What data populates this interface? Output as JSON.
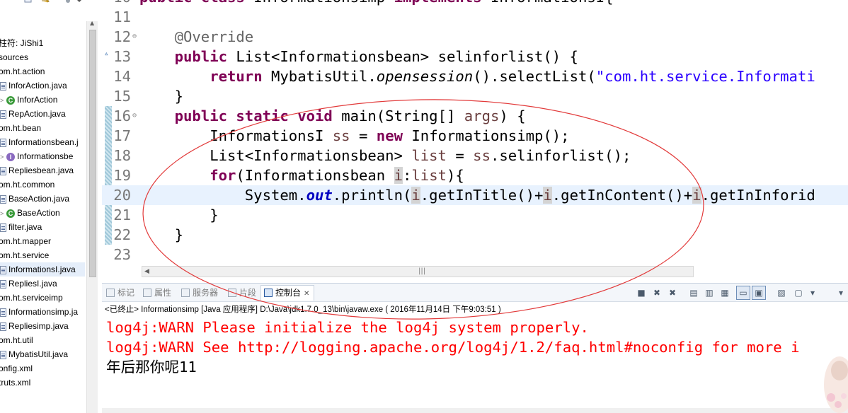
{
  "explorer": {
    "items": [
      {
        "text": "柱符: JiShi1",
        "indent": 0,
        "icon": "none"
      },
      {
        "text": "sources",
        "indent": 0,
        "icon": "none"
      },
      {
        "text": "om.ht.action",
        "indent": 0,
        "icon": "none"
      },
      {
        "text": "InforAction.java",
        "indent": 1,
        "icon": "java-file"
      },
      {
        "text": "InforAction",
        "indent": 2,
        "icon": "class"
      },
      {
        "text": "RepAction.java",
        "indent": 1,
        "icon": "java-file"
      },
      {
        "text": "om.ht.bean",
        "indent": 0,
        "icon": "none"
      },
      {
        "text": "Informationsbean.j",
        "indent": 1,
        "icon": "java-file"
      },
      {
        "text": "Informationsbe",
        "indent": 2,
        "icon": "interface"
      },
      {
        "text": "Repliesbean.java",
        "indent": 1,
        "icon": "java-file"
      },
      {
        "text": "om.ht.common",
        "indent": 0,
        "icon": "none"
      },
      {
        "text": "BaseAction.java",
        "indent": 1,
        "icon": "java-file"
      },
      {
        "text": "BaseAction",
        "indent": 2,
        "icon": "class"
      },
      {
        "text": "filter.java",
        "indent": 1,
        "icon": "java-file"
      },
      {
        "text": "om.ht.mapper",
        "indent": 0,
        "icon": "none"
      },
      {
        "text": "om.ht.service",
        "indent": 0,
        "icon": "none"
      },
      {
        "text": "InformationsI.java",
        "indent": 1,
        "icon": "java-file"
      },
      {
        "text": "RepliesI.java",
        "indent": 1,
        "icon": "java-file"
      },
      {
        "text": "om.ht.serviceimp",
        "indent": 0,
        "icon": "none"
      },
      {
        "text": "Informationsimp.ja",
        "indent": 1,
        "icon": "java-file"
      },
      {
        "text": "Repliesimp.java",
        "indent": 1,
        "icon": "java-file"
      },
      {
        "text": "om.ht.util",
        "indent": 0,
        "icon": "none"
      },
      {
        "text": "MybatisUtil.java",
        "indent": 1,
        "icon": "java-file"
      },
      {
        "text": "onfig.xml",
        "indent": 0,
        "icon": "none"
      },
      {
        "text": "truts.xml",
        "indent": 0,
        "icon": "none"
      }
    ]
  },
  "editor": {
    "partial_top_line": {
      "number": "10",
      "tokens": [
        {
          "t": "public class ",
          "c": "kw"
        },
        {
          "t": "Informationsimp ",
          "c": ""
        },
        {
          "t": "implements ",
          "c": "kw"
        },
        {
          "t": "InformationsI{",
          "c": ""
        }
      ]
    },
    "lines": [
      {
        "number": "11",
        "fold": "",
        "tokens": []
      },
      {
        "number": "12",
        "fold": "⊖",
        "tokens": [
          {
            "t": "    ",
            "c": ""
          },
          {
            "t": "@Override",
            "c": "ann"
          }
        ]
      },
      {
        "number": "13",
        "fold": "",
        "marker": "▵",
        "tokens": [
          {
            "t": "    ",
            "c": ""
          },
          {
            "t": "public ",
            "c": "kw"
          },
          {
            "t": "List<Informationsbean> selinforlist() {",
            "c": ""
          }
        ]
      },
      {
        "number": "14",
        "fold": "",
        "tokens": [
          {
            "t": "        ",
            "c": ""
          },
          {
            "t": "return ",
            "c": "kw"
          },
          {
            "t": "MybatisUtil.",
            "c": ""
          },
          {
            "t": "opensession",
            "c": "itl"
          },
          {
            "t": "().selectList(",
            "c": ""
          },
          {
            "t": "\"com.ht.service.Informati",
            "c": "str"
          }
        ]
      },
      {
        "number": "15",
        "fold": "",
        "tokens": [
          {
            "t": "    }",
            "c": ""
          }
        ]
      },
      {
        "number": "16",
        "fold": "⊖",
        "tokens": [
          {
            "t": "    ",
            "c": ""
          },
          {
            "t": "public static void ",
            "c": "kw"
          },
          {
            "t": "main(String[] ",
            "c": ""
          },
          {
            "t": "args",
            "c": "var"
          },
          {
            "t": ") {",
            "c": ""
          }
        ]
      },
      {
        "number": "17",
        "fold": "",
        "tokens": [
          {
            "t": "        InformationsI ",
            "c": ""
          },
          {
            "t": "ss",
            "c": "var"
          },
          {
            "t": " = ",
            "c": ""
          },
          {
            "t": "new ",
            "c": "kw"
          },
          {
            "t": "Informationsimp();",
            "c": ""
          }
        ]
      },
      {
        "number": "18",
        "fold": "",
        "tokens": [
          {
            "t": "        List<Informationsbean> ",
            "c": ""
          },
          {
            "t": "list",
            "c": "var"
          },
          {
            "t": " = ",
            "c": ""
          },
          {
            "t": "ss",
            "c": "var"
          },
          {
            "t": ".selinforlist();",
            "c": ""
          }
        ]
      },
      {
        "number": "19",
        "fold": "",
        "tokens": [
          {
            "t": "        ",
            "c": ""
          },
          {
            "t": "for",
            "c": "kw"
          },
          {
            "t": "(Informationsbean ",
            "c": ""
          },
          {
            "t": "i",
            "c": "var occ"
          },
          {
            "t": ":",
            "c": ""
          },
          {
            "t": "list",
            "c": "var"
          },
          {
            "t": "){",
            "c": ""
          }
        ]
      },
      {
        "number": "20",
        "fold": "",
        "current": true,
        "tokens": [
          {
            "t": "            System.",
            "c": ""
          },
          {
            "t": "out",
            "c": "fld"
          },
          {
            "t": ".println(",
            "c": ""
          },
          {
            "t": "i",
            "c": "var occ"
          },
          {
            "t": ".getInTitle()+",
            "c": ""
          },
          {
            "t": "i",
            "c": "var occ"
          },
          {
            "t": ".getInContent()+",
            "c": ""
          },
          {
            "t": "i",
            "c": "var occ"
          },
          {
            "t": ".getInInforid",
            "c": ""
          }
        ]
      },
      {
        "number": "21",
        "fold": "",
        "tokens": [
          {
            "t": "        }",
            "c": ""
          }
        ]
      },
      {
        "number": "22",
        "fold": "",
        "tokens": [
          {
            "t": "    }",
            "c": ""
          }
        ]
      },
      {
        "number": "23",
        "fold": "",
        "tokens": []
      }
    ]
  },
  "console": {
    "tabs": [
      {
        "label": "标记",
        "icon": "markers-icon"
      },
      {
        "label": "属性",
        "icon": "properties-icon"
      },
      {
        "label": "服务器",
        "icon": "servers-icon"
      },
      {
        "label": "片段",
        "icon": "snippets-icon"
      },
      {
        "label": "控制台",
        "icon": "console-icon",
        "active": true
      }
    ],
    "toolbar_icons": [
      "stop-icon",
      "remove-launch-icon",
      "remove-all-icon",
      "scroll-lock-icon",
      "clear-console-icon",
      "word-wrap-icon",
      "pin-console-icon",
      "show-console-icon",
      "display-selected-console-icon",
      "open-console-icon",
      "view-menu-icon"
    ],
    "header": "<已终止> Informationsimp [Java 应用程序] D:\\Java\\jdk1.7.0_13\\bin\\javaw.exe ( 2016年11月14日 下午9:03:51 )",
    "output": [
      {
        "text": "log4j:WARN Please initialize the log4j system properly.",
        "stream": "err"
      },
      {
        "text": "log4j:WARN See http://logging.apache.org/log4j/1.2/faq.html#noconfig for more i",
        "stream": "err"
      },
      {
        "text": "年后那你呢11",
        "stream": "out"
      }
    ]
  },
  "colors": {
    "keyword": "#7f0055",
    "string": "#2a00ff",
    "annotation": "#646464",
    "stderr": "#ff0000",
    "annotation_ellipse": "#e23a3a"
  }
}
